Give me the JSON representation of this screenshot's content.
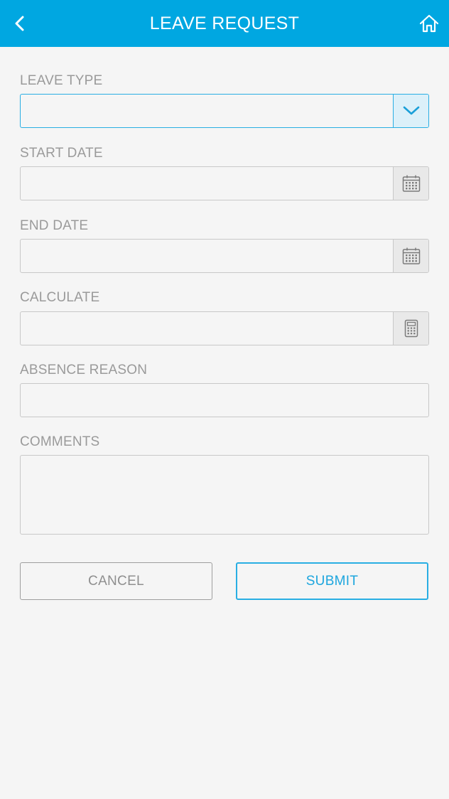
{
  "header": {
    "title": "LEAVE REQUEST",
    "back_icon": "chevron-left-icon",
    "home_icon": "home-icon",
    "background_color": "#00a7e1"
  },
  "form": {
    "leave_type": {
      "label": "LEAVE TYPE",
      "value": "",
      "icon": "chevron-down-icon"
    },
    "start_date": {
      "label": "START DATE",
      "value": "",
      "icon": "calendar-icon"
    },
    "end_date": {
      "label": "END DATE",
      "value": "",
      "icon": "calendar-icon"
    },
    "calculate": {
      "label": "CALCULATE",
      "value": "",
      "icon": "calculator-icon"
    },
    "absence_reason": {
      "label": "ABSENCE REASON",
      "value": ""
    },
    "comments": {
      "label": "COMMENTS",
      "value": ""
    }
  },
  "actions": {
    "cancel_label": "CANCEL",
    "submit_label": "SUBMIT",
    "accent_color": "#29aee3"
  }
}
